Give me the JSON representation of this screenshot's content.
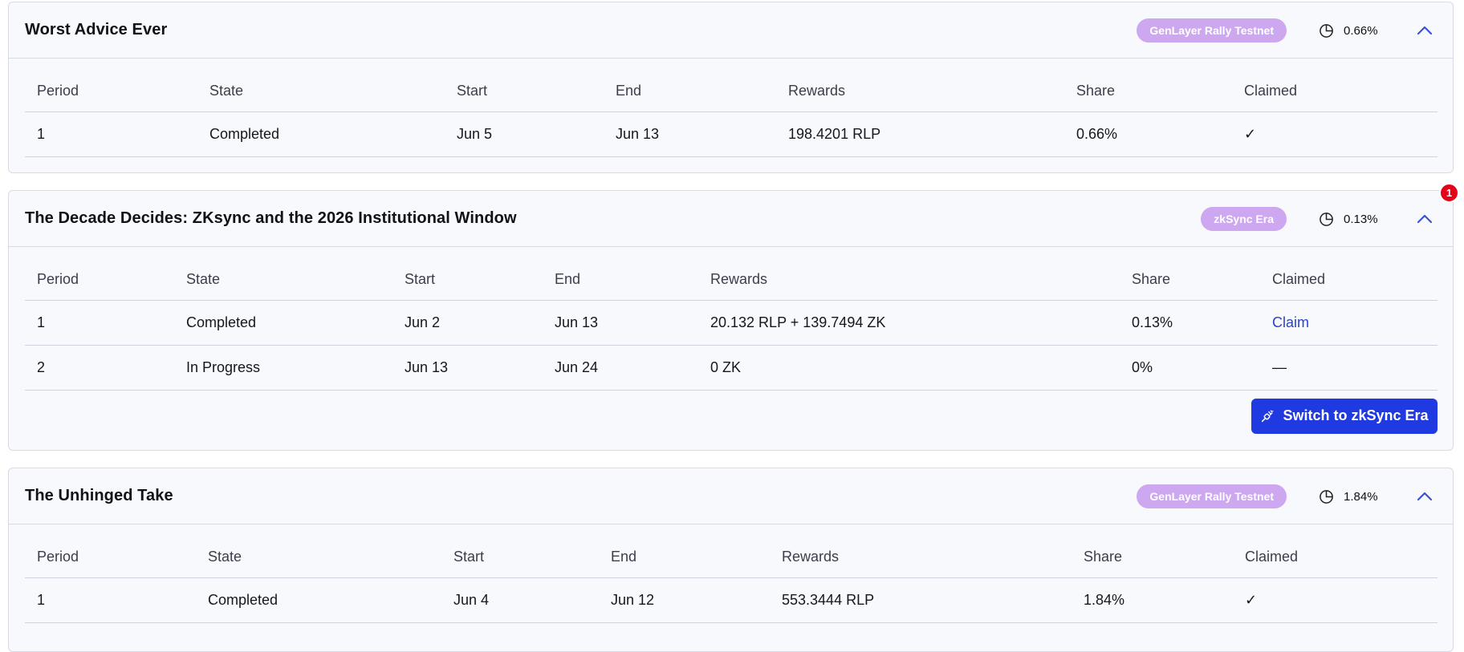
{
  "columns_header": [
    "Period",
    "State",
    "Start",
    "End",
    "Rewards",
    "Share",
    "Claimed"
  ],
  "cards": [
    {
      "title": "Worst Advice Ever",
      "chain": "GenLayer Rally Testnet",
      "share": "0.66%",
      "rows": [
        {
          "period": "1",
          "state": "Completed",
          "start": "Jun 5",
          "end": "Jun 13",
          "rewards": "198.4201 RLP",
          "share": "0.66%",
          "claimed": "✓"
        }
      ]
    },
    {
      "title": "The Decade Decides: ZKsync and the 2026 Institutional Window",
      "chain": "zkSync Era",
      "share": "0.13%",
      "notification_count": "1",
      "rows": [
        {
          "period": "1",
          "state": "Completed",
          "start": "Jun 2",
          "end": "Jun 13",
          "rewards": "20.132 RLP + 139.7494 ZK",
          "share": "0.13%",
          "claimed": "Claim"
        },
        {
          "period": "2",
          "state": "In Progress",
          "start": "Jun 13",
          "end": "Jun 24",
          "rewards": "0 ZK",
          "share": "0%",
          "claimed": "—"
        }
      ],
      "switch_button": "Switch to zkSync Era"
    },
    {
      "title": "The Unhinged Take",
      "chain": "GenLayer Rally Testnet",
      "share": "1.84%",
      "rows": [
        {
          "period": "1",
          "state": "Completed",
          "start": "Jun 4",
          "end": "Jun 12",
          "rewards": "553.3444 RLP",
          "share": "1.84%",
          "claimed": "✓"
        }
      ]
    }
  ],
  "icons": {
    "share": "pie-chart-icon",
    "collapse": "chevron-up-icon",
    "switch": "plug-icon"
  },
  "colors": {
    "badge": "#cda7f0",
    "accent": "#1f3ae0",
    "link": "#2e43c7",
    "notification": "#e6001a"
  }
}
